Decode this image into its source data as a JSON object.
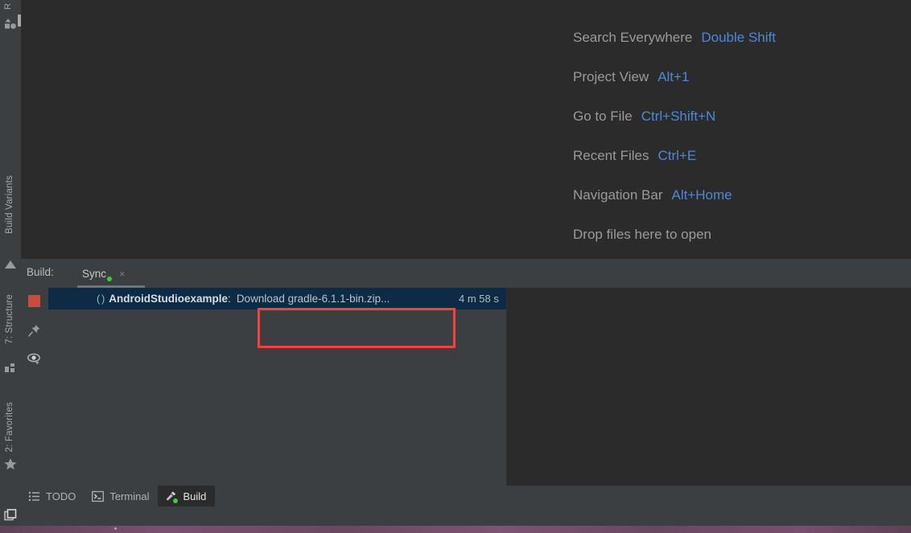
{
  "app": {
    "theme_bg": "#2b2b2b",
    "panel_bg": "#3c3f41",
    "accent_blue": "#4d87d9",
    "selection_bg": "#0d2b45",
    "highlight_red": "#f8403a"
  },
  "left_strip": {
    "top_label": "R",
    "icons": [
      {
        "name": "resource-manager-icon"
      },
      {
        "name": "build-variants-icon"
      },
      {
        "name": "structure-icon"
      },
      {
        "name": "favorites-star-icon"
      }
    ],
    "labels": [
      {
        "text": "Build Variants"
      },
      {
        "text": "7: Structure"
      },
      {
        "text": "2: Favorites"
      }
    ]
  },
  "welcome": {
    "rows": [
      {
        "label": "Search Everywhere",
        "shortcut": "Double Shift"
      },
      {
        "label": "Project View",
        "shortcut": "Alt+1"
      },
      {
        "label": "Go to File",
        "shortcut": "Ctrl+Shift+N"
      },
      {
        "label": "Recent Files",
        "shortcut": "Ctrl+E"
      },
      {
        "label": "Navigation Bar",
        "shortcut": "Alt+Home"
      },
      {
        "label": "Drop files here to open",
        "shortcut": ""
      }
    ]
  },
  "build_window": {
    "title": "Build:",
    "tab": {
      "label": "Sync",
      "status_dot": "green",
      "close_glyph": "×"
    },
    "gutter": [
      {
        "name": "stop-button",
        "tooltip": "Stop"
      },
      {
        "name": "pin-tab-icon",
        "tooltip": "Pin Tab"
      },
      {
        "name": "eye-filter-icon",
        "tooltip": "Filter"
      }
    ],
    "row": {
      "spinner": "( )",
      "project": "AndroidStudioexample",
      "separator": ":",
      "task": "Download gradle-6.1.1-bin.zip...",
      "duration": "4 m 58 s"
    }
  },
  "bottom_bar": {
    "buttons": [
      {
        "label": "TODO",
        "icon": "todo-list-icon",
        "active": false
      },
      {
        "label": "Terminal",
        "icon": "terminal-icon",
        "active": false
      },
      {
        "label": "Build",
        "icon": "hammer-icon",
        "active": true
      }
    ]
  },
  "status_bar": {
    "icon": "window-restore-icon"
  }
}
